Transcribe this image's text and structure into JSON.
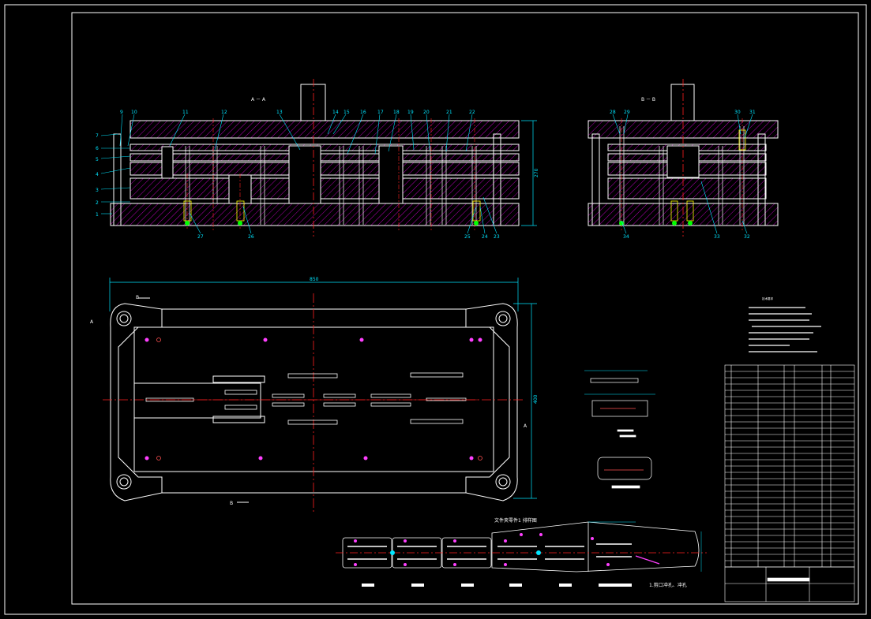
{
  "drawing": {
    "section_aa_label": "A － A",
    "section_bb_label": "B － B",
    "dim_top_width": "850",
    "dim_right_height": "400",
    "dim_section_height": "270",
    "view_marker_a_left": "A",
    "view_marker_a_right": "A",
    "view_marker_b_top": "B",
    "view_marker_b_bottom": "B",
    "strip_title": "文件夹零件1   排样图",
    "strip_note": "1.剪口冲孔、冲孔",
    "leader_numbers_left_side": [
      "7",
      "6",
      "5",
      "4",
      "3",
      "2",
      "1"
    ],
    "leader_numbers_top_aa": [
      "9",
      "10",
      "11",
      "12",
      "13",
      "14",
      "15",
      "16",
      "17",
      "18",
      "19",
      "20",
      "21",
      "22"
    ],
    "leader_numbers_bottom_aa": [
      "27",
      "26",
      "25",
      "24",
      "23"
    ],
    "leader_numbers_top_bb": [
      "28",
      "29",
      "30",
      "31"
    ],
    "leader_numbers_bottom_bb": [
      "34",
      "33",
      "32"
    ],
    "tech_notes_title": "技术要求"
  },
  "colors": {
    "background": "#000000",
    "outline": "#ffffff",
    "dimension": "#00e5ff",
    "centerline": "#ff2020",
    "hatch": "#c000c0",
    "yellow": "#ffff00",
    "green": "#00ff00"
  }
}
